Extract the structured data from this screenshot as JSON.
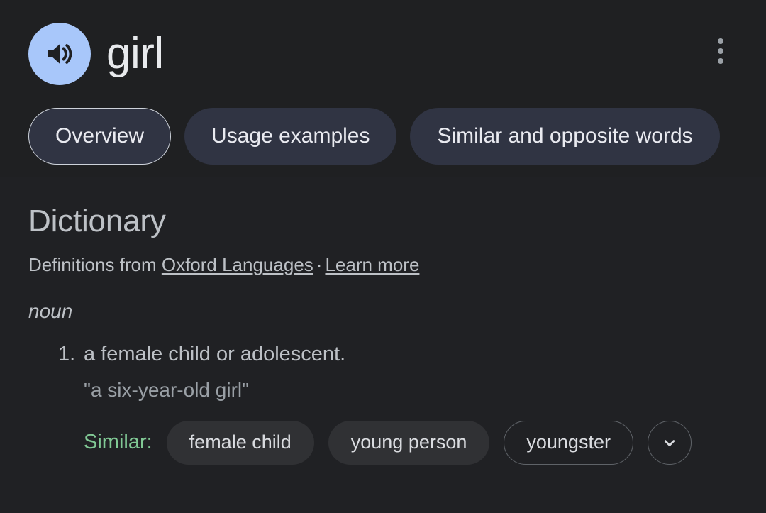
{
  "header": {
    "word": "girl",
    "speaker_icon": "speaker-volume-icon",
    "overflow_icon": "kebab-menu-icon",
    "tabs": [
      {
        "label": "Overview",
        "selected": true
      },
      {
        "label": "Usage examples",
        "selected": false
      },
      {
        "label": "Similar and opposite words",
        "selected": false
      }
    ]
  },
  "dictionary": {
    "title": "Dictionary",
    "attribution_prefix": "Definitions from ",
    "source_link": "Oxford Languages",
    "separator": "·",
    "learn_more_link": "Learn more",
    "part_of_speech": "noun",
    "definitions": [
      {
        "number": "1.",
        "text": "a female child or adolescent.",
        "example": "\"a six-year-old girl\"",
        "similar_label": "Similar:",
        "synonyms": [
          {
            "label": "female child",
            "style": "filled"
          },
          {
            "label": "young person",
            "style": "filled"
          },
          {
            "label": "youngster",
            "style": "outlined"
          }
        ],
        "expand_icon": "chevron-down-icon"
      }
    ]
  },
  "colors": {
    "background": "#202124",
    "header_background": "#1f2022",
    "speaker_accent": "#a8c7fa",
    "tab_chip": "#303443",
    "synonym_chip": "#303134",
    "similar_label": "#81c995",
    "primary_text": "#e8eaed",
    "secondary_text": "#bdc1c6",
    "muted_text": "#9aa0a6"
  }
}
